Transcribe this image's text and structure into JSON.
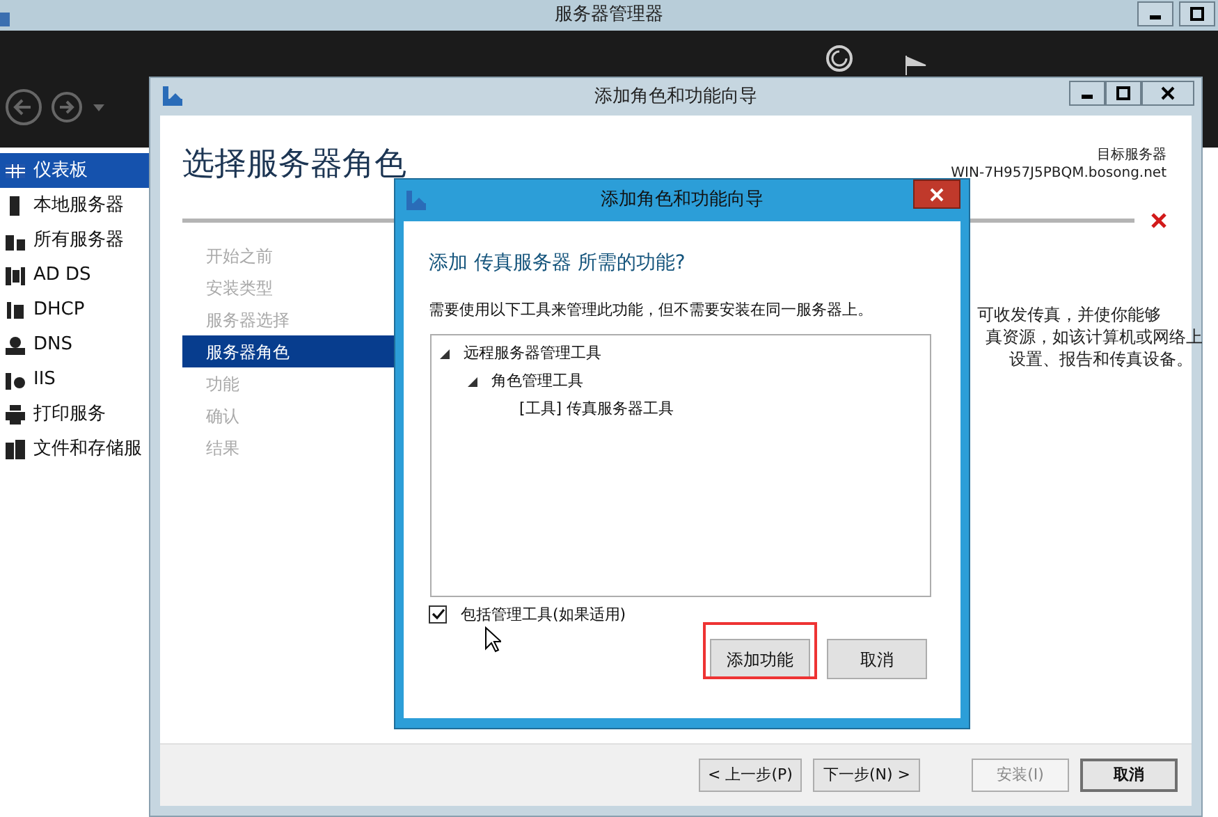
{
  "server_manager": {
    "title": "服务器管理器",
    "sidebar": [
      {
        "label": "仪表板",
        "selected": true
      },
      {
        "label": "本地服务器",
        "selected": false
      },
      {
        "label": "所有服务器",
        "selected": false
      },
      {
        "label": "AD DS",
        "selected": false
      },
      {
        "label": "DHCP",
        "selected": false
      },
      {
        "label": "DNS",
        "selected": false
      },
      {
        "label": "IIS",
        "selected": false
      },
      {
        "label": "打印服务",
        "selected": false
      },
      {
        "label": "文件和存储服",
        "selected": false
      }
    ]
  },
  "wizard": {
    "title": "添加角色和功能向导",
    "heading": "选择服务器角色",
    "target_label": "目标服务器",
    "target_server": "WIN-7H957J5PBQM.bosong.net",
    "steps": [
      {
        "label": "开始之前",
        "selected": false
      },
      {
        "label": "安装类型",
        "selected": false
      },
      {
        "label": "服务器选择",
        "selected": false
      },
      {
        "label": "服务器角色",
        "selected": true
      },
      {
        "label": "功能",
        "selected": false
      },
      {
        "label": "确认",
        "selected": false
      },
      {
        "label": "结果",
        "selected": false
      }
    ],
    "description": {
      "lines": [
        "可收发传真，并使你能够",
        "真资源，如该计算机或网络上",
        "设置、报告和传真设备。"
      ]
    },
    "buttons": [
      {
        "label": "< 上一步(P)",
        "disabled": false,
        "default": false
      },
      {
        "label": "下一步(N) >",
        "disabled": false,
        "default": false
      },
      {
        "label": "安装(I)",
        "disabled": true,
        "default": false
      },
      {
        "label": "取消",
        "disabled": false,
        "default": true
      }
    ]
  },
  "dialog": {
    "title": "添加角色和功能向导",
    "heading": "添加 传真服务器 所需的功能?",
    "text": "需要使用以下工具来管理此功能，但不需要安装在同一服务器上。",
    "tree": [
      {
        "label": "远程服务器管理工具",
        "expanded": true,
        "children": [
          {
            "label": "角色管理工具",
            "expanded": true,
            "children": [
              {
                "label": "[工具] 传真服务器工具"
              }
            ]
          }
        ]
      }
    ],
    "checkbox": {
      "label": "包括管理工具(如果适用)",
      "checked": true
    },
    "buttons": [
      {
        "label": "添加功能",
        "highlighted": true
      },
      {
        "label": "取消",
        "highlighted": false
      }
    ]
  }
}
